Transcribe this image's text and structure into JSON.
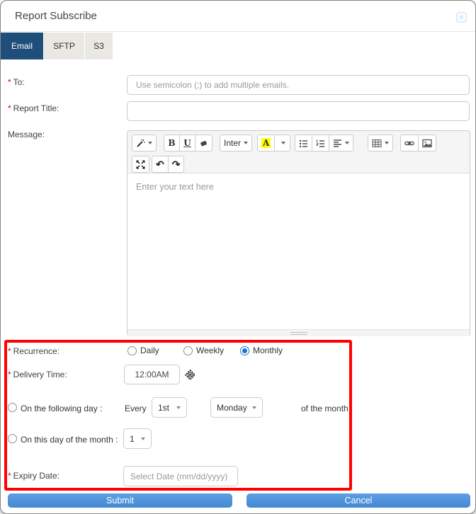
{
  "modal": {
    "title": "Report Subscribe"
  },
  "required_marker": "*",
  "tabs": [
    {
      "label": "Email",
      "active": true
    },
    {
      "label": "SFTP",
      "active": false
    },
    {
      "label": "S3",
      "active": false
    }
  ],
  "fields": {
    "to": {
      "label": "To:",
      "placeholder": "Use semicolon (;) to add multiple emails."
    },
    "report_title": {
      "label": "Report Title:",
      "value": ""
    },
    "message": {
      "label": "Message:"
    }
  },
  "editor": {
    "placeholder": "Enter your text here",
    "bold_label": "B",
    "underline_label": "U",
    "font_name": "Inter",
    "color_label": "A",
    "undo_glyph": "↶",
    "redo_glyph": "↷"
  },
  "recurrence": {
    "label": "Recurrence:",
    "options": [
      {
        "label": "Daily",
        "selected": false
      },
      {
        "label": "Weekly",
        "selected": false
      },
      {
        "label": "Monthly",
        "selected": true
      }
    ]
  },
  "delivery_time": {
    "label": "Delivery Time:",
    "value": "12:00AM"
  },
  "following_day": {
    "label": "On the following day :",
    "every_label": "Every",
    "ordinal_value": "1st",
    "weekday_value": "Monday",
    "suffix_label": "of the month"
  },
  "day_of_month": {
    "label": "On this day of the month :",
    "value": "1"
  },
  "expiry": {
    "label": "Expiry Date:",
    "placeholder": "Select Date (mm/dd/yyyy)"
  },
  "footer": {
    "submit_label": "Submit",
    "cancel_label": "Cancel"
  },
  "colors": {
    "tab_active_bg": "#1e4e79",
    "highlight_border": "#ff0000",
    "button_blue": "#4f92da",
    "required_red": "#d40000",
    "radio_selected": "#1a73d8",
    "highlight_yellow": "#ffff00"
  }
}
